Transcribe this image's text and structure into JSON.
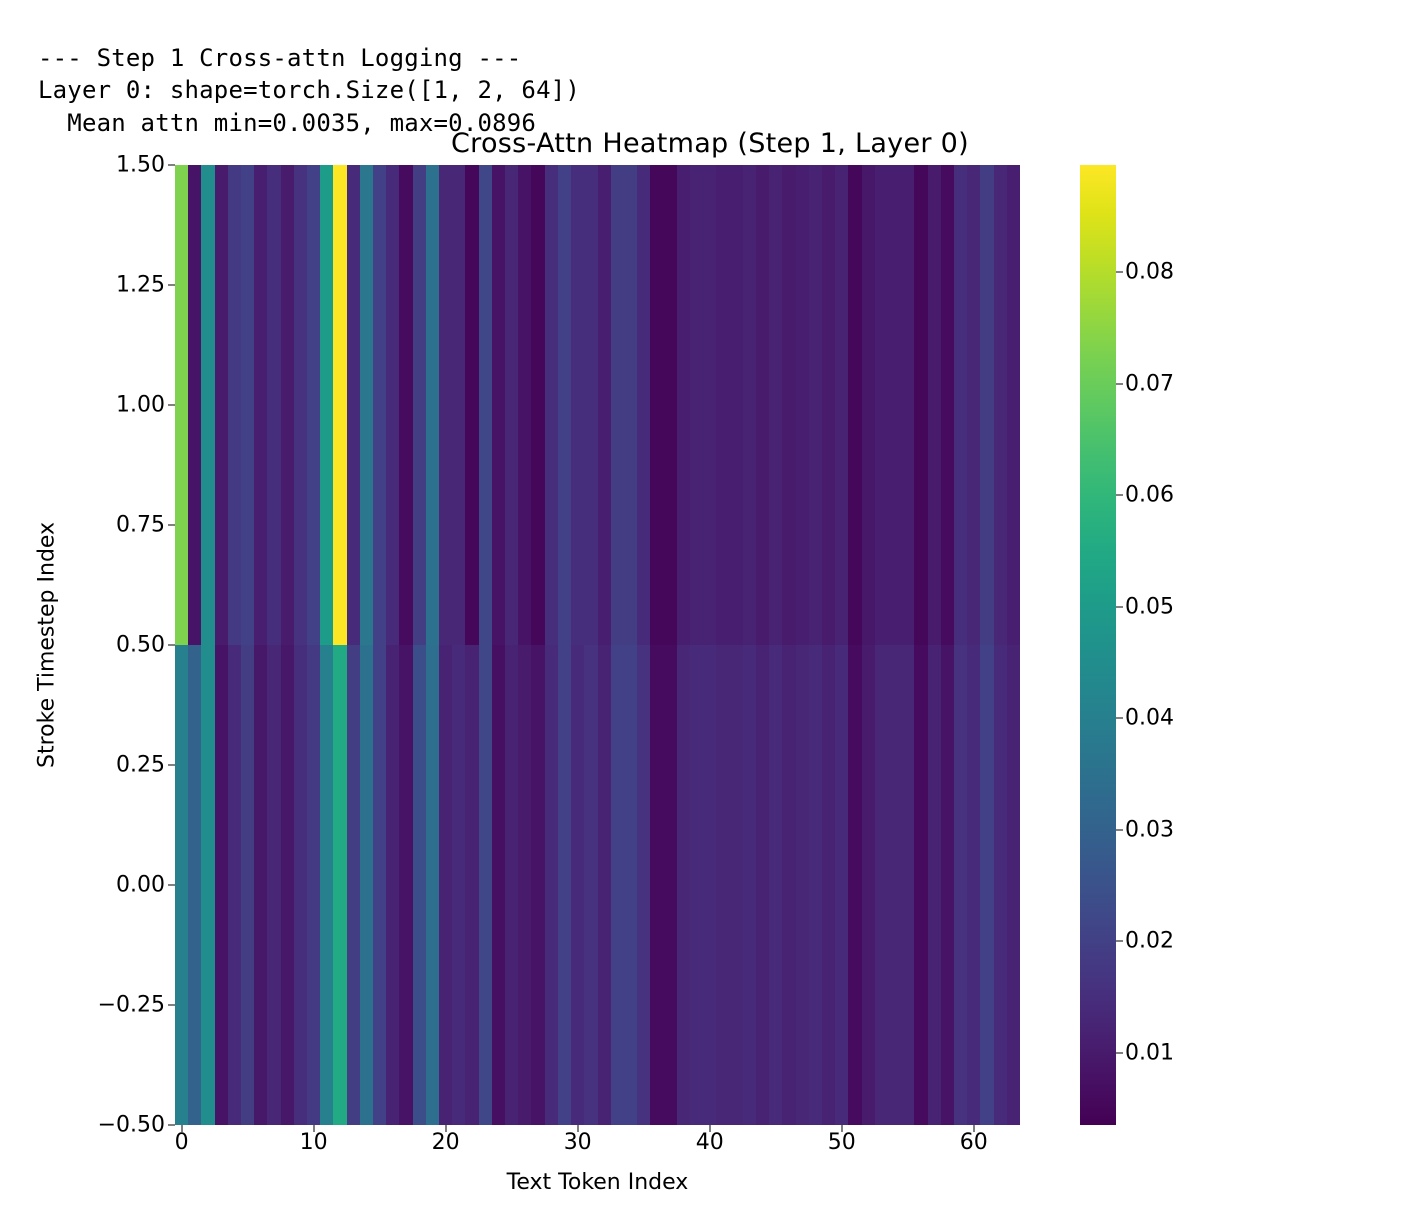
{
  "log": {
    "line1": "--- Step 1 Cross-attn Logging ---",
    "line2": "Layer 0: shape=torch.Size([1, 2, 64])",
    "line3": "  Mean attn min=0.0035, max=0.0896"
  },
  "chart_data": {
    "type": "heatmap",
    "title": "Cross-Attn Heatmap (Step 1, Layer 0)",
    "xlabel": "Text Token Index",
    "ylabel": "Stroke Timestep Index",
    "x": [
      0,
      1,
      2,
      3,
      4,
      5,
      6,
      7,
      8,
      9,
      10,
      11,
      12,
      13,
      14,
      15,
      16,
      17,
      18,
      19,
      20,
      21,
      22,
      23,
      24,
      25,
      26,
      27,
      28,
      29,
      30,
      31,
      32,
      33,
      34,
      35,
      36,
      37,
      38,
      39,
      40,
      41,
      42,
      43,
      44,
      45,
      46,
      47,
      48,
      49,
      50,
      51,
      52,
      53,
      54,
      55,
      56,
      57,
      58,
      59,
      60,
      61,
      62,
      63
    ],
    "y_rows": [
      0,
      1
    ],
    "values": [
      [
        0.04,
        0.03,
        0.045,
        0.008,
        0.014,
        0.019,
        0.009,
        0.013,
        0.009,
        0.015,
        0.018,
        0.04,
        0.055,
        0.019,
        0.035,
        0.02,
        0.012,
        0.008,
        0.024,
        0.034,
        0.012,
        0.014,
        0.012,
        0.022,
        0.007,
        0.012,
        0.01,
        0.008,
        0.014,
        0.02,
        0.014,
        0.016,
        0.012,
        0.02,
        0.02,
        0.016,
        0.006,
        0.006,
        0.013,
        0.014,
        0.014,
        0.013,
        0.013,
        0.014,
        0.012,
        0.014,
        0.012,
        0.013,
        0.014,
        0.012,
        0.014,
        0.006,
        0.01,
        0.013,
        0.013,
        0.013,
        0.006,
        0.012,
        0.008,
        0.016,
        0.014,
        0.02,
        0.014,
        0.012
      ],
      [
        0.073,
        0.008,
        0.045,
        0.01,
        0.018,
        0.02,
        0.011,
        0.015,
        0.01,
        0.016,
        0.02,
        0.05,
        0.09,
        0.014,
        0.037,
        0.02,
        0.014,
        0.006,
        0.019,
        0.035,
        0.013,
        0.013,
        0.005,
        0.022,
        0.008,
        0.013,
        0.008,
        0.005,
        0.015,
        0.02,
        0.015,
        0.015,
        0.011,
        0.019,
        0.019,
        0.014,
        0.005,
        0.005,
        0.011,
        0.012,
        0.012,
        0.011,
        0.011,
        0.012,
        0.01,
        0.012,
        0.01,
        0.011,
        0.012,
        0.01,
        0.012,
        0.005,
        0.009,
        0.011,
        0.011,
        0.011,
        0.005,
        0.01,
        0.006,
        0.015,
        0.013,
        0.019,
        0.013,
        0.011
      ]
    ],
    "vmin": 0.0035,
    "vmax": 0.0896,
    "xlim": [
      -0.5,
      63.5
    ],
    "ylim": [
      -0.5,
      1.5
    ],
    "x_ticks": [
      0,
      10,
      20,
      30,
      40,
      50,
      60
    ],
    "y_ticks": [
      -0.5,
      -0.25,
      0.0,
      0.25,
      0.5,
      0.75,
      1.0,
      1.25,
      1.5
    ],
    "x_tick_labels": [
      "0",
      "10",
      "20",
      "30",
      "40",
      "50",
      "60"
    ],
    "y_tick_labels": [
      "−0.50",
      "−0.25",
      "0.00",
      "0.25",
      "0.50",
      "0.75",
      "1.00",
      "1.25",
      "1.50"
    ],
    "colorbar_ticks": [
      0.01,
      0.02,
      0.03,
      0.04,
      0.05,
      0.06,
      0.07,
      0.08
    ],
    "colorbar_tick_labels": [
      "0.01",
      "0.02",
      "0.03",
      "0.04",
      "0.05",
      "0.06",
      "0.07",
      "0.08"
    ],
    "colormap": "viridis"
  }
}
